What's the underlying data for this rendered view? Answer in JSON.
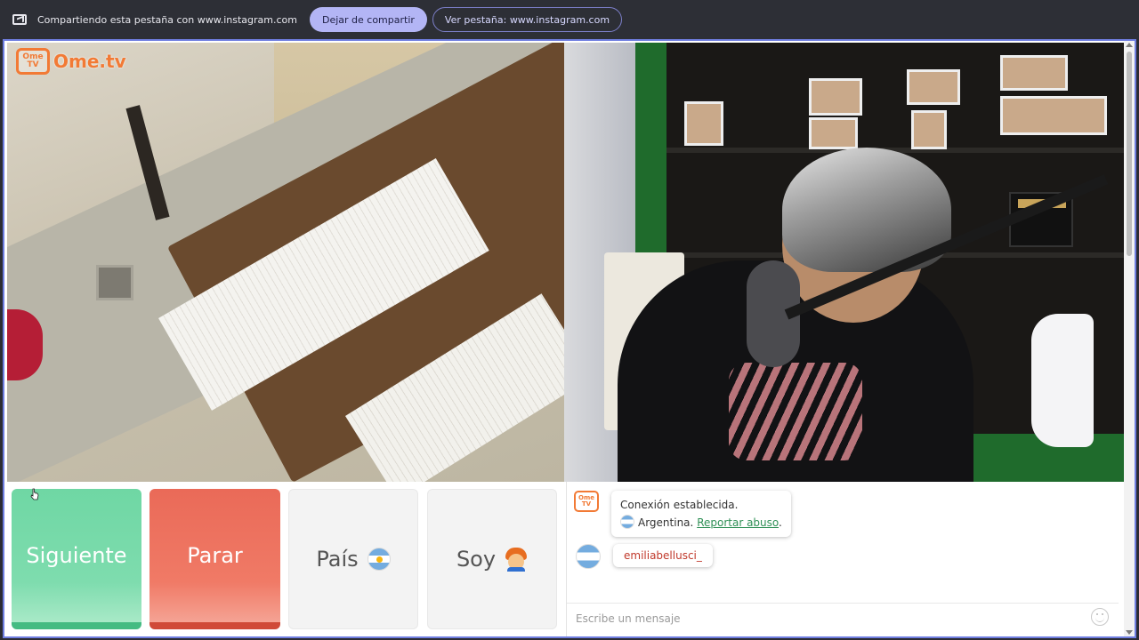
{
  "share_bar": {
    "text": "Compartiendo esta pestaña con www.instagram.com",
    "stop_label": "Dejar de compartir",
    "view_label": "Ver pestaña: www.instagram.com"
  },
  "logo": {
    "tv_line1": "Ome",
    "tv_line2": "TV",
    "text": "Ome.tv"
  },
  "controls": {
    "next_label": "Siguiente",
    "stop_label": "Parar",
    "country_label": "País",
    "gender_label": "Soy"
  },
  "chat": {
    "system_line1": "Conexión establecida.",
    "system_country": "Argentina.",
    "report_label": "Reportar abuso",
    "report_suffix": ".",
    "user_message": "emiliabellusci_",
    "input_placeholder": "Escribe un mensaje"
  },
  "colors": {
    "next": "#6fd7a4",
    "stop": "#ea6a58",
    "brand": "#f27a35",
    "share_accent": "#b3b5f5"
  },
  "icons": {
    "share": "screen-share-icon",
    "country_flag": "argentina-flag-icon",
    "gender": "boy-face-icon",
    "emoji": "smiley-icon"
  }
}
